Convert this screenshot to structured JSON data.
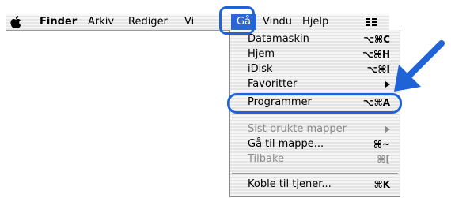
{
  "menubar": {
    "items": [
      {
        "label": "Finder",
        "bold": true
      },
      {
        "label": "Arkiv"
      },
      {
        "label": "Rediger"
      },
      {
        "label": "Vi"
      },
      {
        "label": "Gå"
      },
      {
        "label": "Vindu"
      },
      {
        "label": "Hjelp"
      }
    ]
  },
  "menu": {
    "items": [
      {
        "label": "Datamaskin",
        "shortcut": "⌥⌘C"
      },
      {
        "label": "Hjem",
        "shortcut": "⌥⌘H"
      },
      {
        "label": "iDisk",
        "shortcut": "⌥⌘I"
      },
      {
        "label": "Favoritter"
      },
      {
        "label": "Programmer",
        "shortcut": "⌥⌘A"
      },
      {
        "label": "Sist brukte mapper"
      },
      {
        "label": "Gå til mappe...",
        "shortcut": "⌘~"
      },
      {
        "label": "Tilbake",
        "shortcut": "⌘["
      },
      {
        "label": "Koble til tjener...",
        "shortcut": "⌘K"
      }
    ]
  },
  "colors": {
    "highlight_ring": "#1f63d6",
    "active_menu": "#2d64d8",
    "arrow": "#1f63d6",
    "disabled_text": "#8b8b8b"
  },
  "icons": [
    "apple-icon",
    "submenu-arrow-icon",
    "menu-extras-icon",
    "pointer-arrow-icon"
  ]
}
